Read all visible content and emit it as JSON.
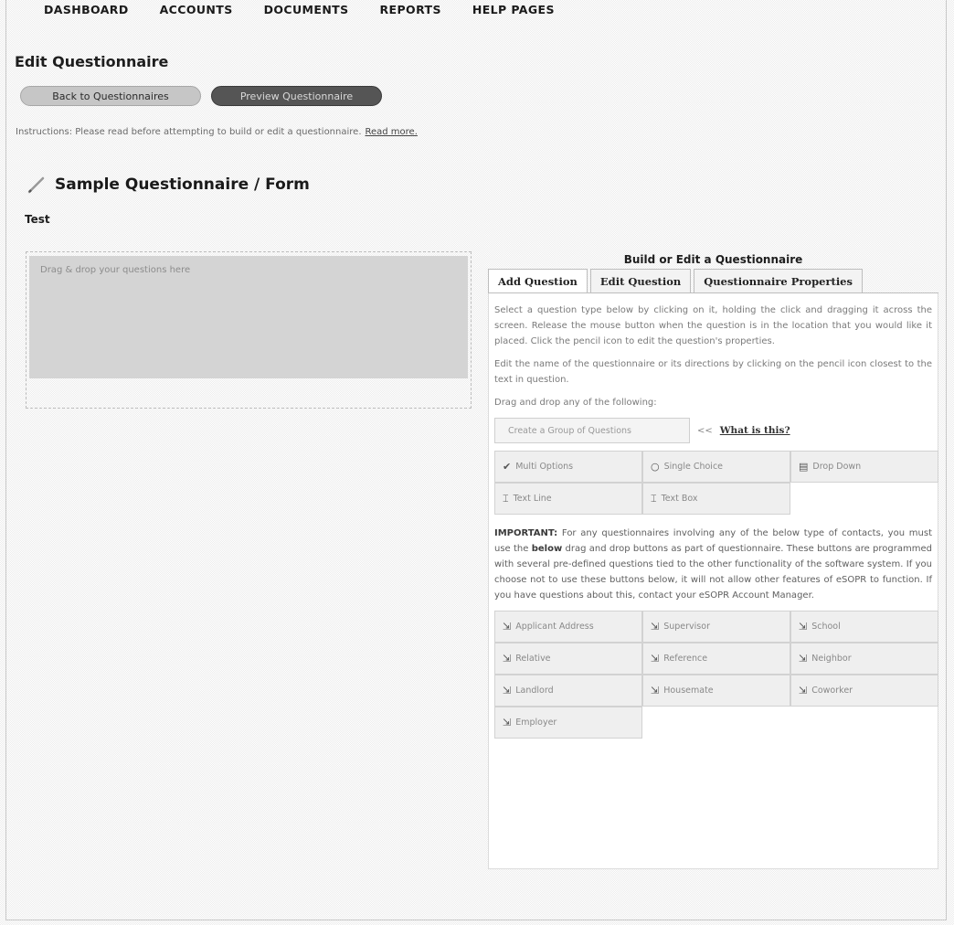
{
  "nav": {
    "items": [
      "DASHBOARD",
      "ACCOUNTS",
      "DOCUMENTS",
      "REPORTS",
      "HELP PAGES"
    ]
  },
  "page": {
    "title": "Edit Questionnaire",
    "back_button": "Back to Questionnaires",
    "preview_button": "Preview Questionnaire",
    "instructions": "Instructions: Please read before attempting to build or edit a questionnaire.",
    "read_more": "Read more."
  },
  "questionnaire": {
    "title": "Sample Questionnaire / Form",
    "subtitle": "Test",
    "drop_placeholder": "Drag & drop your questions here"
  },
  "builder": {
    "heading": "Build or Edit a Questionnaire",
    "tabs": [
      {
        "label": "Add Question"
      },
      {
        "label": "Edit Question"
      },
      {
        "label": "Questionnaire Properties"
      }
    ],
    "para1": "Select a question type below by clicking on it, holding the click and dragging it across the screen. Release the mouse button when the question is in the location that you would like it placed. Click the pencil icon to edit the question's properties.",
    "para2": "Edit the name of the questionnaire or its directions by clicking on the pencil icon closest to the text in question.",
    "drag_label": "Drag and drop any of the following:",
    "group_button": "Create a Group of Questions",
    "group_arrows": "<<",
    "what_is_this": "What is this?",
    "question_types": [
      {
        "label": "Multi Options",
        "icon": "checkmark-icon",
        "glyph": "✔"
      },
      {
        "label": "Single Choice",
        "icon": "radio-icon",
        "glyph": "○"
      },
      {
        "label": "Drop Down",
        "icon": "dropdown-icon",
        "glyph": "▤"
      },
      {
        "label": "Text Line",
        "icon": "text-line-icon",
        "glyph": "⌶"
      },
      {
        "label": "Text Box",
        "icon": "text-box-icon",
        "glyph": "⌶"
      }
    ],
    "important_label": "IMPORTANT:",
    "important_text_1": "For any questionnaires involving any of the below type of contacts, you must use the",
    "important_bold": "below",
    "important_text_2": "drag and drop buttons as part of questionnaire. These buttons are programmed with several pre-defined questions tied to the other functionality of the software system. If you choose not to use these buttons below, it will not allow other features of eSOPR to function. If you have questions about this, contact your eSOPR Account Manager.",
    "contact_types": [
      {
        "label": "Applicant Address"
      },
      {
        "label": "Supervisor"
      },
      {
        "label": "School"
      },
      {
        "label": "Relative"
      },
      {
        "label": "Reference"
      },
      {
        "label": "Neighbor"
      },
      {
        "label": "Landlord"
      },
      {
        "label": "Housemate"
      },
      {
        "label": "Coworker"
      },
      {
        "label": "Employer"
      }
    ]
  }
}
